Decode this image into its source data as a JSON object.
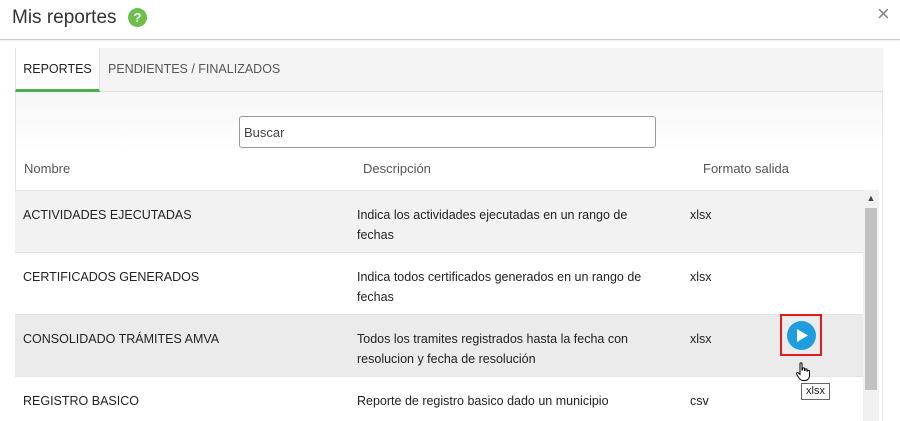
{
  "dialog": {
    "title": "Mis reportes",
    "help_icon": "question-circle-icon",
    "help_glyph": "?",
    "close_icon": "close-icon",
    "close_glyph": "×",
    "colors": {
      "help": "#6cbf4b",
      "accent": "#4caf50",
      "action": "#1e9ddf",
      "highlight": "#e01b1b"
    }
  },
  "tabs": [
    {
      "label": "REPORTES",
      "active": true
    },
    {
      "label": "PENDIENTES / FINALIZADOS",
      "active": false
    }
  ],
  "search": {
    "placeholder": "Buscar",
    "value": ""
  },
  "table": {
    "columns": [
      "Nombre",
      "Descripción",
      "Formato salida"
    ],
    "rows": [
      {
        "name": "ACTIVIDADES EJECUTADAS",
        "description": "Indica los actividades ejecutadas en un rango de fechas",
        "format": "xlsx"
      },
      {
        "name": "CERTIFICADOS GENERADOS",
        "description": "Indica todos certificados generados en un rango de fechas",
        "format": "xlsx"
      },
      {
        "name": "CONSOLIDADO TRÁMITES AMVA",
        "description": "Todos los tramites registrados hasta la fecha con resolucion y fecha de resolución",
        "format": "xlsx",
        "hovered": true
      },
      {
        "name": "REGISTRO BASICO",
        "description": "Reporte de registro basico dado un municipio",
        "format": "csv"
      }
    ]
  },
  "run_button": {
    "icon": "play-icon",
    "tooltip": "xlsx"
  },
  "cursor": {
    "icon": "hand-pointer-icon"
  }
}
